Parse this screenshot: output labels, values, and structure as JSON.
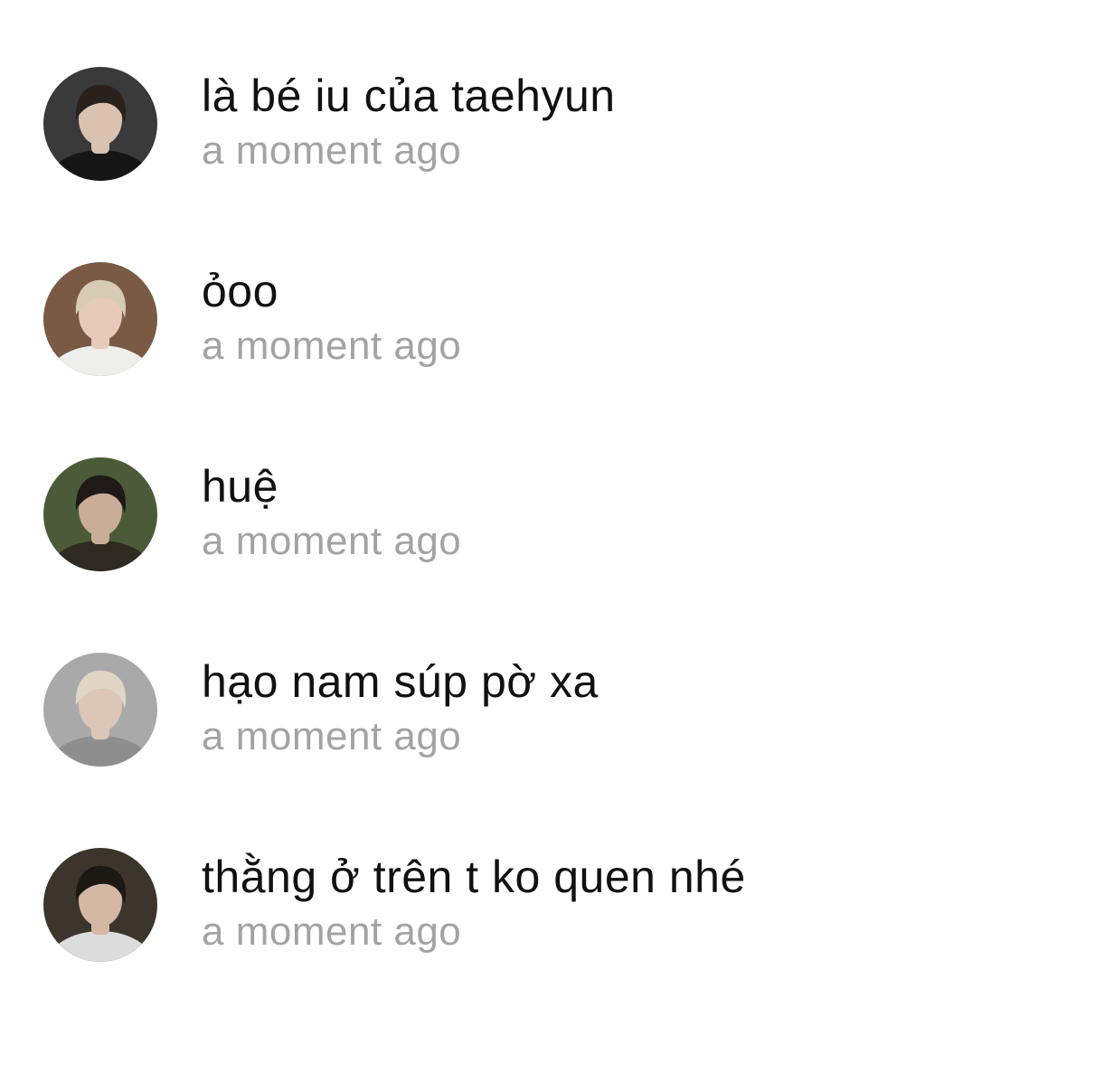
{
  "comments": [
    {
      "text": "là bé iu của taehyun",
      "time": "a moment ago",
      "avatar": {
        "icon": "profile-photo-icon",
        "bg": "#3a3a3a",
        "face": "#d9c2b0",
        "hair": "#2a211c",
        "cloth": "#161616"
      }
    },
    {
      "text": "ỏoo",
      "time": "a moment ago",
      "avatar": {
        "icon": "profile-photo-icon",
        "bg": "#7a5a44",
        "face": "#e6cbbb",
        "hair": "#d8cbb6",
        "cloth": "#eeeeec"
      }
    },
    {
      "text": "huệ",
      "time": "a moment ago",
      "avatar": {
        "icon": "profile-photo-icon",
        "bg": "#4b5b3a",
        "face": "#c9ad98",
        "hair": "#1f1a17",
        "cloth": "#2f2a22"
      }
    },
    {
      "text": "hạo nam súp pờ xa",
      "time": "a moment ago",
      "avatar": {
        "icon": "profile-photo-icon",
        "bg": "#a9a9a9",
        "face": "#dcc6b8",
        "hair": "#e0d6c6",
        "cloth": "#8e8e8e"
      }
    },
    {
      "text": "thằng ở trên t ko quen nhé",
      "time": "a moment ago",
      "avatar": {
        "icon": "profile-photo-icon",
        "bg": "#3b352c",
        "face": "#d4b8a4",
        "hair": "#1c1814",
        "cloth": "#dcdcdc"
      }
    }
  ]
}
